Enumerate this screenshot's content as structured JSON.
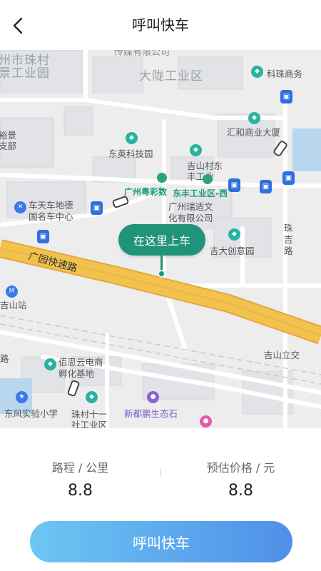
{
  "header": {
    "title": "呼叫快车",
    "back_icon": "chevron-left-icon"
  },
  "map": {
    "labels": {
      "top_partial": "传媒有限公司",
      "zhucun_a": "州市珠村",
      "zhucun_b": "景工业园",
      "dalong": "大陇工业区",
      "kezhu": "科珠商务",
      "yujing_a": "裕景",
      "yujing_b": "支部",
      "huihe": "汇和商业大厦",
      "dongying": "东英科技园",
      "jishan_a": "吉山村东",
      "jishan_b": "丰工业",
      "guangzhou_yue": "广州粤彩数",
      "dongfeng": "东丰工业区-西",
      "chetian_a": "车天车地德",
      "chetian_b": "国名车中心",
      "ruishi_a": "广州瑞适文",
      "ruishi_b": "化有限公司",
      "jida": "吉大创意园",
      "zhuji_a": "珠",
      "zhuji_b": "吉",
      "zhuji_c": "路",
      "guangyuan": "广园快速路",
      "jishan_station": "吉山站",
      "jishan_jiao": "吉山立交",
      "road_partial": "路",
      "baisi_a": "佰思云电商",
      "baisi_b": "孵化基地",
      "dongfeng_school": "东风实验小学",
      "zhucun11_a": "珠村十一",
      "zhucun11_b": "社工业区",
      "xindupeng": "新都鹏生态石"
    }
  },
  "pickup": {
    "label": "在这里上车"
  },
  "stats": {
    "distance_label": "路程 / 公里",
    "distance_value": "8.8",
    "price_label": "预估价格 / 元",
    "price_value": "8.8"
  },
  "cta": {
    "label": "呼叫快车"
  },
  "colors": {
    "accent_green": "#21937a",
    "cta_start": "#6cc7f3",
    "cta_end": "#4f8fe8",
    "highway": "#f2c14e"
  }
}
